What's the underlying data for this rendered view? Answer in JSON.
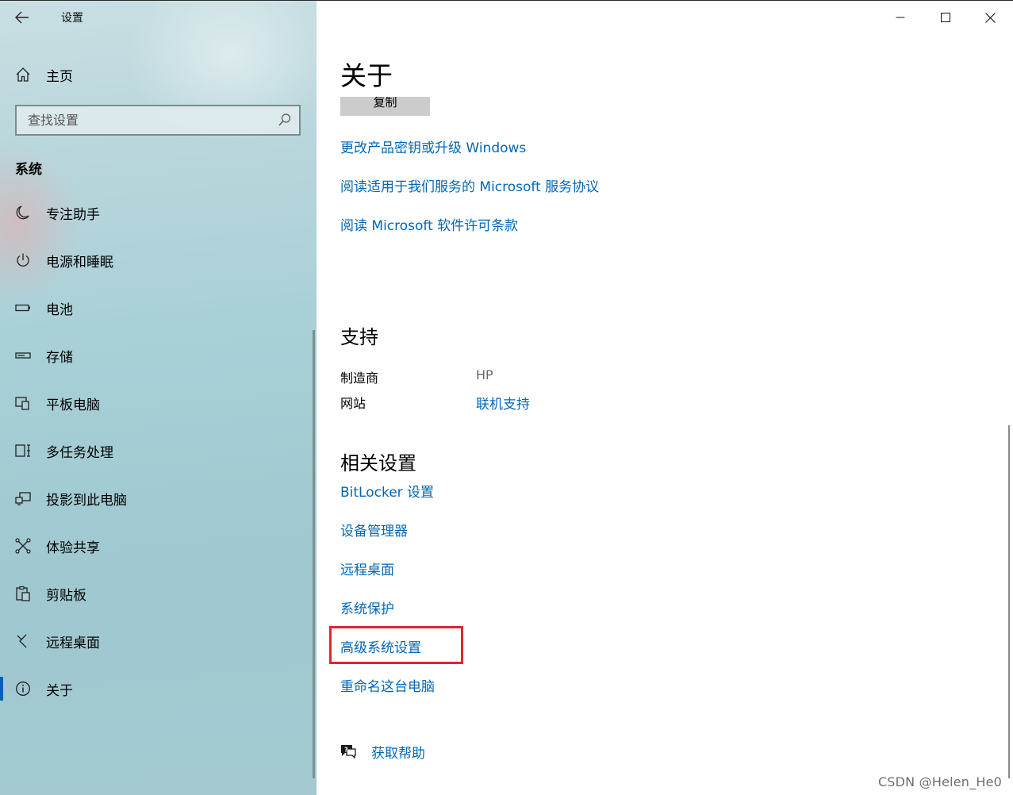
{
  "window": {
    "app_title": "设置",
    "back_icon": "back-arrow-icon",
    "caption_buttons": [
      "minimize",
      "maximize",
      "close"
    ]
  },
  "sidebar": {
    "home_label": "主页",
    "search_placeholder": "查找设置",
    "section_label": "系统",
    "items": [
      {
        "label": "专注助手",
        "icon": "moon-icon"
      },
      {
        "label": "电源和睡眠",
        "icon": "power-icon"
      },
      {
        "label": "电池",
        "icon": "battery-icon"
      },
      {
        "label": "存储",
        "icon": "storage-icon"
      },
      {
        "label": "平板电脑",
        "icon": "tablet-icon"
      },
      {
        "label": "多任务处理",
        "icon": "multitasking-icon"
      },
      {
        "label": "投影到此电脑",
        "icon": "project-icon"
      },
      {
        "label": "体验共享",
        "icon": "share-icon"
      },
      {
        "label": "剪贴板",
        "icon": "clipboard-icon"
      },
      {
        "label": "远程桌面",
        "icon": "remote-desktop-icon"
      },
      {
        "label": "关于",
        "icon": "info-icon",
        "active": true
      }
    ]
  },
  "main": {
    "title": "关于",
    "copy_button": "复制",
    "about_links": [
      "更改产品密钥或升级 Windows",
      "阅读适用于我们服务的 Microsoft 服务协议",
      "阅读 Microsoft 软件许可条款"
    ],
    "support": {
      "heading": "支持",
      "manufacturer_label": "制造商",
      "manufacturer_value": "HP",
      "website_label": "网站",
      "website_value": "联机支持"
    },
    "related": {
      "heading": "相关设置",
      "links": [
        "BitLocker 设置",
        "设备管理器",
        "远程桌面",
        "系统保护",
        "高级系统设置",
        "重命名这台电脑"
      ],
      "highlighted_index": 4,
      "highlight_color": "#e0262e"
    },
    "help_label": "获取帮助"
  },
  "colors": {
    "link": "#0067b8",
    "accent": "#0063b1"
  },
  "watermark": "CSDN @Helen_He0"
}
